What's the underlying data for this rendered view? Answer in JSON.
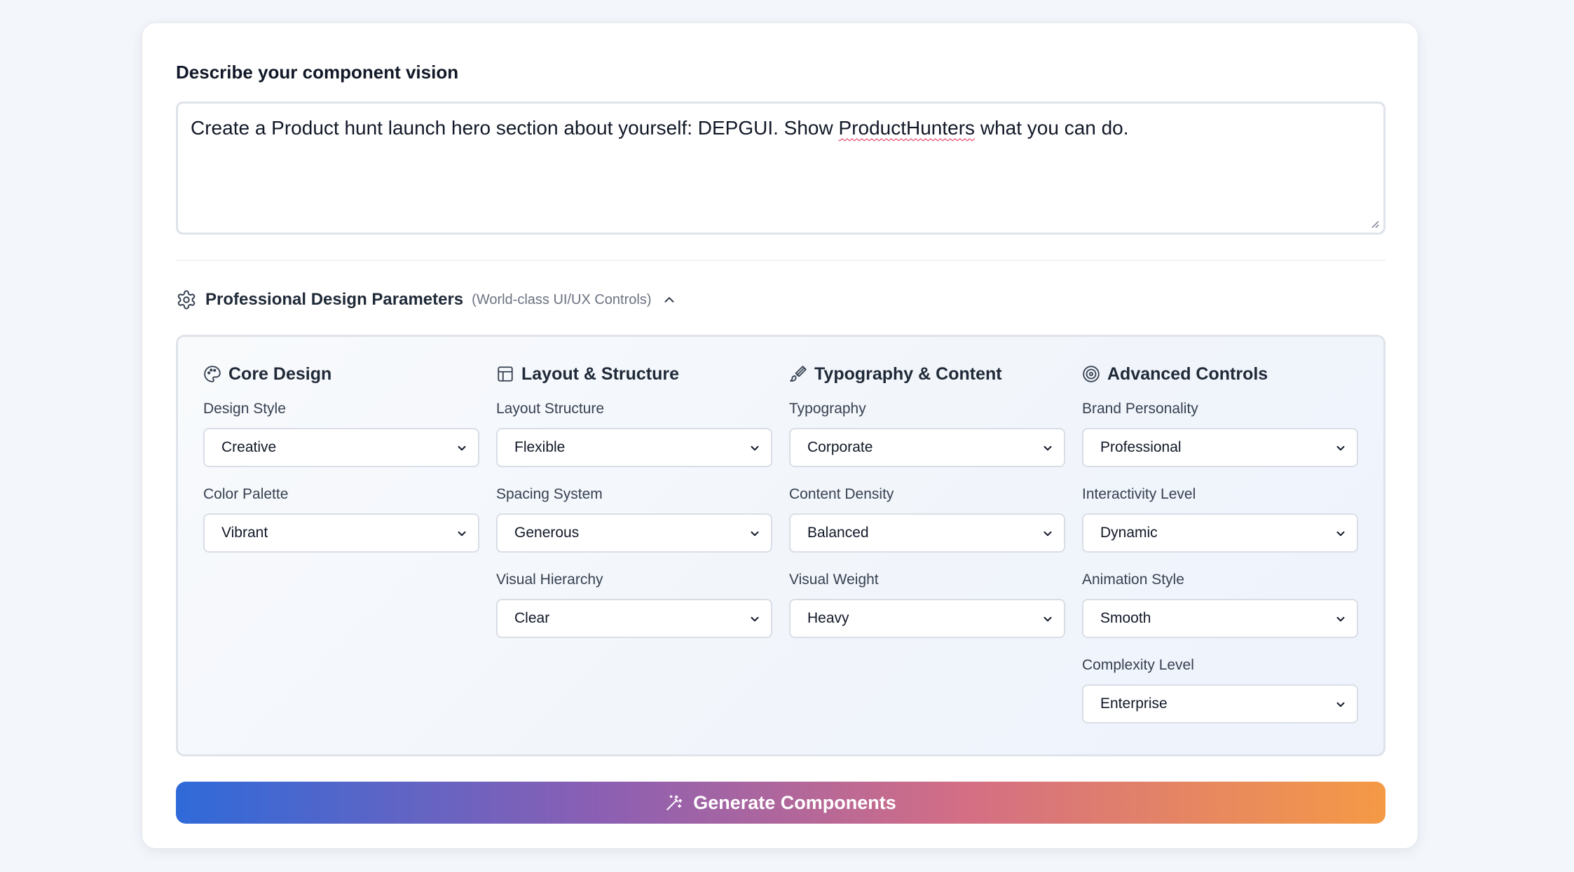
{
  "vision": {
    "label": "Describe your component vision",
    "text_before": "Create a Product hunt launch hero section about yourself: DEPGUI. Show ",
    "text_misspelled": "ProductHunters",
    "text_after": " what you can do."
  },
  "params": {
    "title": "Professional Design Parameters",
    "subtitle": "(World-class UI/UX Controls)",
    "expanded": true,
    "columns": [
      {
        "title": "Core Design",
        "icon": "palette-icon",
        "fields": [
          {
            "label": "Design Style",
            "value": "Creative"
          },
          {
            "label": "Color Palette",
            "value": "Vibrant"
          }
        ]
      },
      {
        "title": "Layout & Structure",
        "icon": "layout-icon",
        "fields": [
          {
            "label": "Layout Structure",
            "value": "Flexible"
          },
          {
            "label": "Spacing System",
            "value": "Generous"
          },
          {
            "label": "Visual Hierarchy",
            "value": "Clear"
          }
        ]
      },
      {
        "title": "Typography & Content",
        "icon": "brush-icon",
        "fields": [
          {
            "label": "Typography",
            "value": "Corporate"
          },
          {
            "label": "Content Density",
            "value": "Balanced"
          },
          {
            "label": "Visual Weight",
            "value": "Heavy"
          }
        ]
      },
      {
        "title": "Advanced Controls",
        "icon": "target-icon",
        "fields": [
          {
            "label": "Brand Personality",
            "value": "Professional"
          },
          {
            "label": "Interactivity Level",
            "value": "Dynamic"
          },
          {
            "label": "Animation Style",
            "value": "Smooth"
          },
          {
            "label": "Complexity Level",
            "value": "Enterprise"
          }
        ]
      }
    ]
  },
  "generate": {
    "label": "Generate Components",
    "icon": "magic-wand-icon",
    "gradient": [
      "#2f6ad9",
      "#8b5fb3",
      "#d36e85",
      "#f59a45"
    ]
  },
  "colors": {
    "page_bg": "#f3f6fb",
    "border": "#dfe3ea",
    "misspell_underline": "#e11d48"
  }
}
